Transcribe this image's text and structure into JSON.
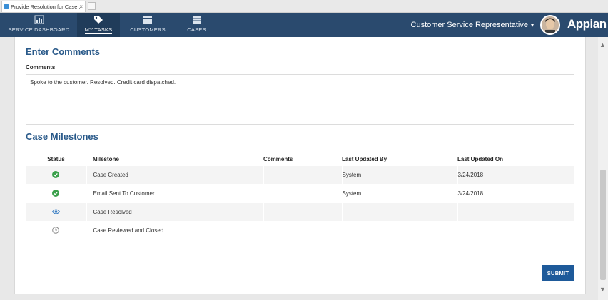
{
  "browser": {
    "tab_title": "Provide Resolution for Case...",
    "tab_close": "×"
  },
  "nav": {
    "items": [
      {
        "label": "SERVICE DASHBOARD",
        "icon": "bar-chart-icon"
      },
      {
        "label": "MY TASKS",
        "icon": "tag-icon",
        "active": true
      },
      {
        "label": "CUSTOMERS",
        "icon": "list-icon"
      },
      {
        "label": "CASES",
        "icon": "stack-icon"
      }
    ],
    "role": "Customer Service Representative",
    "role_caret": "▾",
    "logo": "Appian"
  },
  "form": {
    "comments_section_title": "Enter Comments",
    "comments_label": "Comments",
    "comments_value": "Spoke to the customer. Resolved. Credit card dispatched.",
    "milestones_title": "Case Milestones",
    "columns": [
      "Status",
      "Milestone",
      "Comments",
      "Last Updated By",
      "Last Updated On"
    ],
    "rows": [
      {
        "status": "completed",
        "milestone": "Case Created",
        "comments": "",
        "updated_by": "System",
        "updated_on": "3/24/2018"
      },
      {
        "status": "completed",
        "milestone": "Email Sent To Customer",
        "comments": "",
        "updated_by": "System",
        "updated_on": "3/24/2018"
      },
      {
        "status": "in-progress",
        "milestone": "Case Resolved",
        "comments": "",
        "updated_by": "",
        "updated_on": ""
      },
      {
        "status": "pending",
        "milestone": "Case Reviewed and Closed",
        "comments": "",
        "updated_by": "",
        "updated_on": ""
      }
    ],
    "submit_label": "SUBMIT"
  },
  "colors": {
    "header_bg": "#2a4a6e",
    "title_color": "#2a5a8a",
    "submit_bg": "#1e5a9a",
    "check_green": "#3aa04a",
    "eye_blue": "#3b7fc4"
  }
}
